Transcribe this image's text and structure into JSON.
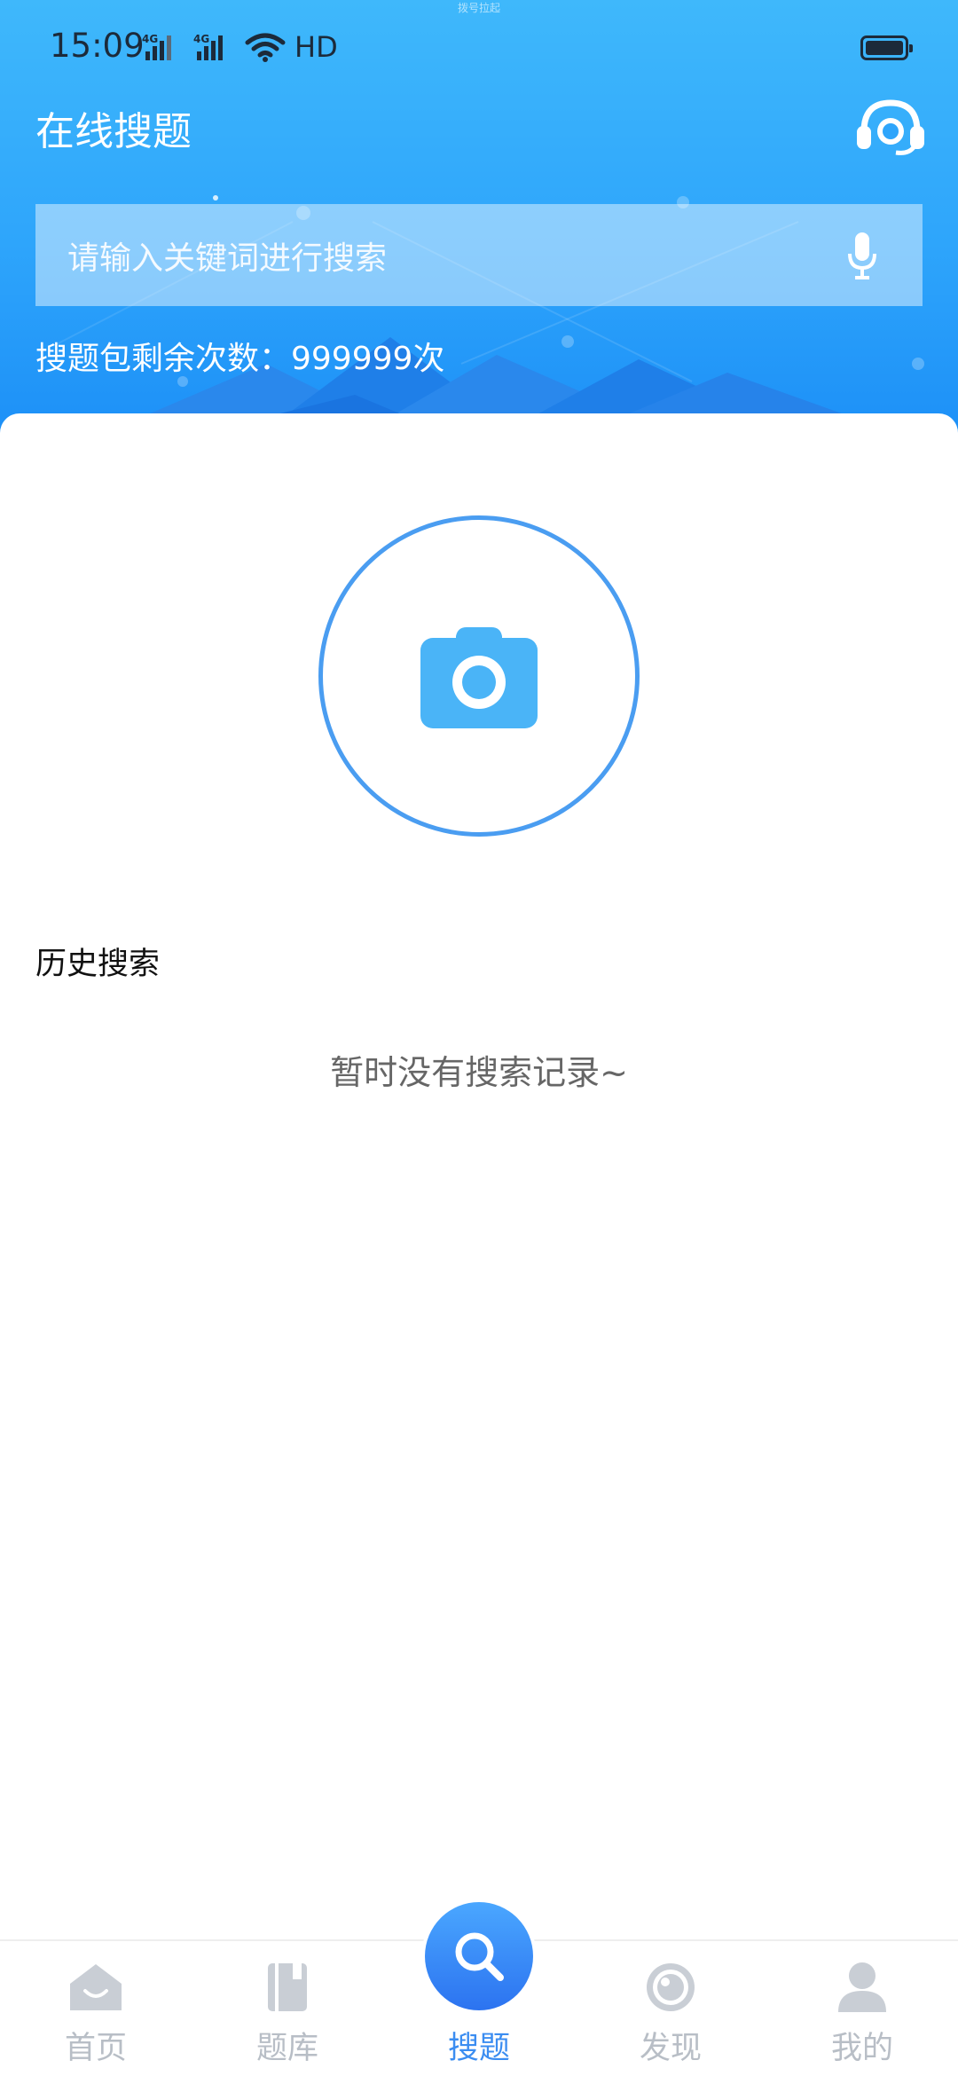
{
  "status_bar": {
    "time": "15:09",
    "network_1": "4G",
    "network_2": "4G",
    "hd_label": "HD",
    "top_notice": "拨号拉起",
    "battery_level": 0.9
  },
  "header": {
    "title": "在线搜题",
    "service_icon": "headset-icon"
  },
  "search": {
    "placeholder": "请输入关键词进行搜索",
    "voice_icon": "microphone-icon"
  },
  "package": {
    "remaining_text": "搜题包剩余次数：999999次"
  },
  "camera": {
    "icon": "camera-icon"
  },
  "history": {
    "title": "历史搜索",
    "empty_text": "暂时没有搜索记录~"
  },
  "tabbar": {
    "tabs": [
      {
        "label": "首页",
        "icon": "home-icon",
        "active": false
      },
      {
        "label": "题库",
        "icon": "book-icon",
        "active": false
      },
      {
        "label": "搜题",
        "icon": "search-icon",
        "active": true
      },
      {
        "label": "发现",
        "icon": "discover-icon",
        "active": false
      },
      {
        "label": "我的",
        "icon": "profile-icon",
        "active": false
      }
    ]
  },
  "colors": {
    "header_blue": "#3fb8fb",
    "accent_blue": "#3b8df1",
    "camera_blue": "#4ab4f7",
    "tab_inactive": "#b8bec6"
  }
}
